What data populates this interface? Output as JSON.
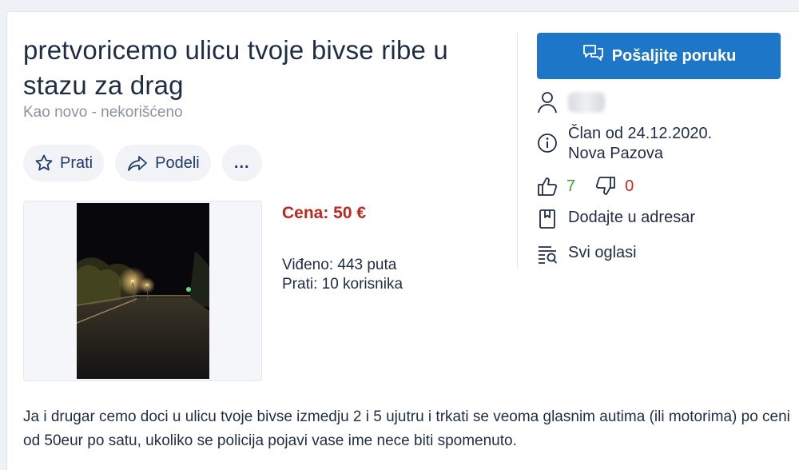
{
  "listing": {
    "title": "pretvoricemo ulicu tvoje bivse ribe u stazu za drag",
    "condition": "Kao novo - nekorišćeno",
    "price": "Cena: 50 €",
    "views": "Viđeno: 443 puta",
    "followers": "Prati: 10 korisnika",
    "description": "Ja i drugar cemo doci u ulicu tvoje bivse izmedju 2 i 5 ujutru i trkati se veoma glasnim autima (ili motorima) po ceni od 50eur po satu, ukoliko se policija pojavi vase ime nece biti spomenuto."
  },
  "actions": {
    "follow_label": "Prati",
    "share_label": "Podeli",
    "more_label": "..."
  },
  "seller": {
    "send_message_label": "Pošaljite poruku",
    "member_since": "Član od 24.12.2020.",
    "location": "Nova Pazova",
    "likes": "7",
    "dislikes": "0",
    "add_to_addressbook_label": "Dodajte u adresar",
    "all_ads_label": "Svi oglasi"
  },
  "icons": {
    "follow": "star-icon",
    "share": "share-icon",
    "message": "chat-icon",
    "user": "user-icon",
    "info": "info-icon",
    "like": "thumbs-up-icon",
    "dislike": "thumbs-down-icon",
    "addressbook": "bookmark-icon",
    "all_ads": "list-icon"
  },
  "colors": {
    "primary_button": "#1e76c8",
    "price": "#c0281f",
    "likes": "#3e9f2f",
    "dislikes": "#d2261c"
  }
}
